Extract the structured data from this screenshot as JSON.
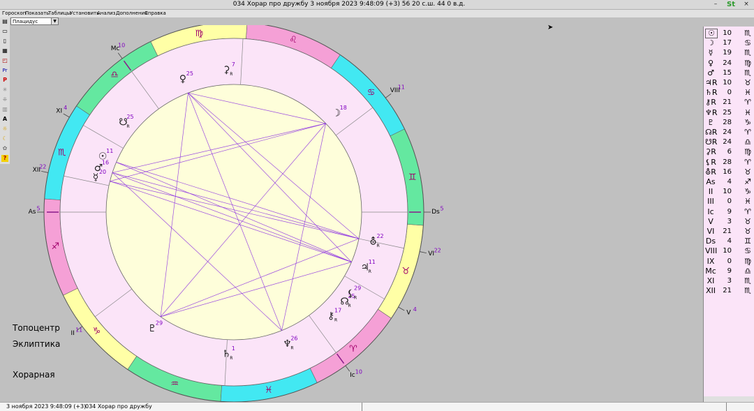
{
  "window": {
    "title": "034 Хорар про дружбу  3 ноября 2023 9:48:09 (+3)   56 20 с.ш.  44  0 в.д.",
    "logo": "St",
    "min_glyph": "–",
    "close_glyph": "×"
  },
  "menu": [
    "Гороскоп",
    "Показать",
    "Таблицы",
    "Установить",
    "Анализ",
    "Дополнения",
    "Справка"
  ],
  "house_system": "Плацидус",
  "toolbar_icons": [
    "document-icon",
    "folder-open-icon",
    "file-icon",
    "save-icon",
    "print-icon",
    "pr-icon",
    "p-icon",
    "asterisk-icon",
    "grid-icon",
    "table-icon",
    "a-icon",
    "sun-icon",
    "moon-icon",
    "gear-icon",
    "help-icon"
  ],
  "toolbar_glyphs": [
    "▤",
    "▭",
    "▯",
    "▦",
    "◰",
    "Pr",
    "P",
    "✳",
    "⁜",
    "▥",
    "A",
    "☼",
    "☾",
    "✿",
    "?"
  ],
  "left_labels": [
    "Топоцентр",
    "Эклиптика",
    "Хорарная"
  ],
  "status": {
    "datetime": "3 ноября 2023  9:48:09 (+3)",
    "name": "034 Хорар про дружбу"
  },
  "colors": {
    "fire": "#f5a0d6",
    "earth": "#ffffa6",
    "air": "#64e8a0",
    "water": "#42e8f2",
    "inner_ring": "#fbe4f8",
    "center": "#fefeda",
    "aspect_line": "#8a2be2",
    "retro_degree": "#8000c0"
  },
  "zodiac_glyphs": [
    "♈",
    "♉",
    "♊",
    "♋",
    "♌",
    "♍",
    "♎",
    "♏",
    "♐",
    "♑",
    "♒",
    "♓"
  ],
  "ascendant_longitude": 244,
  "cusps": [
    {
      "label": "As",
      "degree": "5",
      "lon": 244
    },
    {
      "label": "II",
      "degree": "11",
      "lon": 281
    },
    {
      "label": "III",
      "degree": "1",
      "lon": 331
    },
    {
      "label": "Ic",
      "degree": "10",
      "lon": 10
    },
    {
      "label": "V",
      "degree": "4",
      "lon": 34
    },
    {
      "label": "VI",
      "degree": "22",
      "lon": 52
    },
    {
      "label": "Ds",
      "degree": "5",
      "lon": 64
    },
    {
      "label": "VIII",
      "degree": "11",
      "lon": 101
    },
    {
      "label": "IX",
      "degree": "1",
      "lon": 151
    },
    {
      "label": "Mc",
      "degree": "10",
      "lon": 190
    },
    {
      "label": "XI",
      "degree": "4",
      "lon": 214
    },
    {
      "label": "XII",
      "degree": "22",
      "lon": 232
    }
  ],
  "planets": [
    {
      "name": "sun",
      "glyph": "☉",
      "degree": "11",
      "retro": false,
      "lon": 221
    },
    {
      "name": "moon",
      "glyph": "☽",
      "degree": "18",
      "retro": false,
      "lon": 108
    },
    {
      "name": "mercury",
      "glyph": "☿",
      "degree": "20",
      "retro": false,
      "lon": 230
    },
    {
      "name": "venus",
      "glyph": "♀",
      "degree": "25",
      "retro": false,
      "lon": 175
    },
    {
      "name": "mars",
      "glyph": "♂",
      "degree": "16",
      "retro": false,
      "lon": 226
    },
    {
      "name": "jupiter",
      "glyph": "♃",
      "degree": "11",
      "retro": true,
      "lon": 41
    },
    {
      "name": "saturn",
      "glyph": "♄",
      "degree": "1",
      "retro": true,
      "lon": 331
    },
    {
      "name": "chiron",
      "glyph": "⚷",
      "degree": "17",
      "retro": true,
      "lon": 17
    },
    {
      "name": "uranus",
      "glyph": "⛢",
      "degree": "22",
      "retro": true,
      "lon": 52
    },
    {
      "name": "neptune",
      "glyph": "♆",
      "degree": "26",
      "retro": true,
      "lon": 356
    },
    {
      "name": "pluto",
      "glyph": "♇",
      "degree": "29",
      "retro": false,
      "lon": 299
    },
    {
      "name": "north-node",
      "glyph": "☊",
      "degree": "25",
      "retro": true,
      "lon": 25
    },
    {
      "name": "south-node",
      "glyph": "☋",
      "degree": "25",
      "retro": true,
      "lon": 205
    },
    {
      "name": "lilith",
      "glyph": "⚸",
      "degree": "29",
      "retro": true,
      "lon": 29
    },
    {
      "name": "selena",
      "glyph": "⚳",
      "degree": "7",
      "retro": true,
      "lon": 157
    }
  ],
  "aspects": [
    [
      "mars",
      "jupiter"
    ],
    [
      "mars",
      "uranus"
    ],
    [
      "mercury",
      "jupiter"
    ],
    [
      "mercury",
      "uranus"
    ],
    [
      "sun",
      "jupiter"
    ],
    [
      "sun",
      "uranus"
    ],
    [
      "mars",
      "moon"
    ],
    [
      "mercury",
      "moon"
    ],
    [
      "mars",
      "neptune"
    ],
    [
      "neptune",
      "venus"
    ],
    [
      "pluto",
      "venus"
    ],
    [
      "pluto",
      "moon"
    ],
    [
      "pluto",
      "uranus"
    ],
    [
      "uranus",
      "venus"
    ],
    [
      "jupiter",
      "venus"
    ],
    [
      "neptune",
      "moon"
    ],
    [
      "moon",
      "venus"
    ],
    [
      "pluto",
      "jupiter"
    ]
  ],
  "positions_table": [
    {
      "sym": "☉",
      "deg": "10",
      "sign": "♏"
    },
    {
      "sym": "☽",
      "deg": "17",
      "sign": "♋"
    },
    {
      "sym": "☿",
      "deg": "19",
      "sign": "♏"
    },
    {
      "sym": "♀",
      "deg": "24",
      "sign": "♍"
    },
    {
      "sym": "♂",
      "deg": "15",
      "sign": "♏"
    },
    {
      "sym": "♃R",
      "deg": "10",
      "sign": "♉"
    },
    {
      "sym": "♄R",
      "deg": "0",
      "sign": "♓"
    },
    {
      "sym": "⚷R",
      "deg": "21",
      "sign": "♈"
    },
    {
      "sym": "♆R",
      "deg": "25",
      "sign": "♓"
    },
    {
      "sym": "♇",
      "deg": "28",
      "sign": "♑"
    },
    {
      "sym": "☊R",
      "deg": "24",
      "sign": "♈"
    },
    {
      "sym": "☋R",
      "deg": "24",
      "sign": "♎"
    },
    {
      "sym": "⚳R",
      "deg": "6",
      "sign": "♍"
    },
    {
      "sym": "⚸R",
      "deg": "28",
      "sign": "♈"
    },
    {
      "sym": "⛢R",
      "deg": "16",
      "sign": "♉"
    },
    {
      "sym": "As",
      "deg": "4",
      "sign": "♐"
    },
    {
      "sym": "II",
      "deg": "10",
      "sign": "♑"
    },
    {
      "sym": "III",
      "deg": "0",
      "sign": "♓"
    },
    {
      "sym": "Ic",
      "deg": "9",
      "sign": "♈"
    },
    {
      "sym": "V",
      "deg": "3",
      "sign": "♉"
    },
    {
      "sym": "VI",
      "deg": "21",
      "sign": "♉"
    },
    {
      "sym": "Ds",
      "deg": "4",
      "sign": "♊"
    },
    {
      "sym": "VIII",
      "deg": "10",
      "sign": "♋"
    },
    {
      "sym": "IX",
      "deg": "0",
      "sign": "♍"
    },
    {
      "sym": "Mc",
      "deg": "9",
      "sign": "♎"
    },
    {
      "sym": "XI",
      "deg": "3",
      "sign": "♏"
    },
    {
      "sym": "XII",
      "deg": "21",
      "sign": "♏"
    }
  ]
}
